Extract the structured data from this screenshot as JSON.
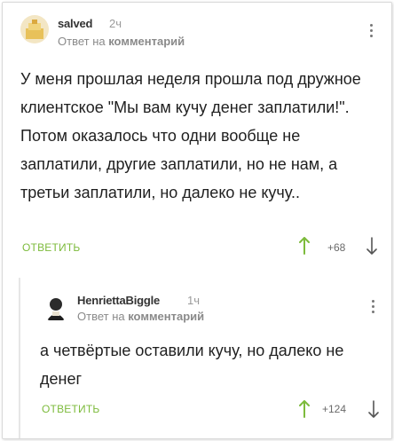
{
  "comment1": {
    "username": "salved",
    "time": "2ч",
    "reply_prefix": "Ответ на ",
    "reply_target": "комментарий",
    "paragraphs": [
      "У меня прошлая неделя прошла под дружное клиентское \"Мы вам кучу денег заплатили!\".",
      "Потом оказалось что одни вообще не заплатили, другие заплатили, но не нам, а третьи заплатили, но далеко не кучу.."
    ],
    "reply_label": "ОТВЕТИТЬ",
    "score": "+68"
  },
  "comment2": {
    "username": "HenriettaBiggle",
    "time": "1ч",
    "reply_prefix": "Ответ на ",
    "reply_target": "комментарий",
    "paragraphs": [
      "а четвёртые оставили кучу, но далеко не денег"
    ],
    "reply_label": "ОТВЕТИТЬ",
    "score": "+124"
  },
  "colors": {
    "accent_green": "#7dbb3c",
    "text": "#1f1f1f",
    "muted": "#8a8a8a"
  }
}
